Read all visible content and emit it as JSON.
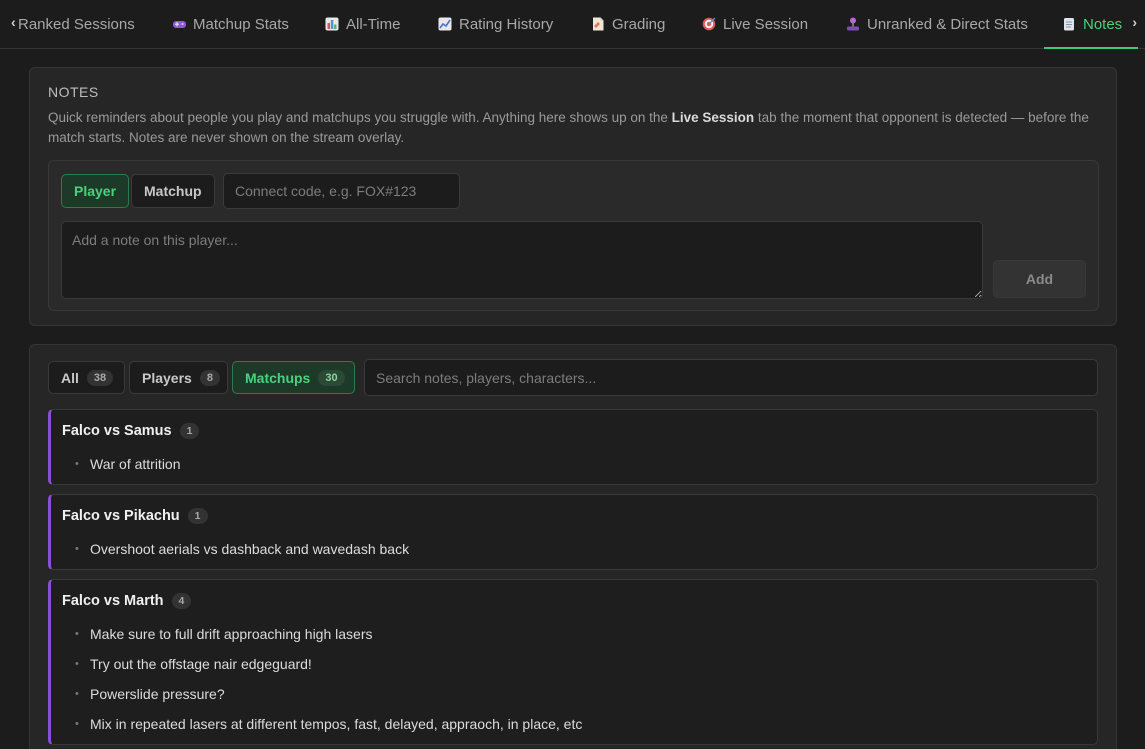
{
  "tabs": [
    {
      "label": "Ranked Sessions",
      "icon": "controller-icon",
      "color": "#d0d0d0"
    },
    {
      "label": "Matchup Stats",
      "icon": "gamepad-icon",
      "color": "#8a5bd6"
    },
    {
      "label": "All-Time",
      "icon": "bar-chart-icon",
      "color": "#5b8ed6"
    },
    {
      "label": "Rating History",
      "icon": "line-chart-icon",
      "color": "#7a8fd6"
    },
    {
      "label": "Grading",
      "icon": "document-icon",
      "color": "#e07a5a"
    },
    {
      "label": "Live Session",
      "icon": "target-icon",
      "color": "#e05a5a"
    },
    {
      "label": "Unranked & Direct Stats",
      "icon": "joystick-icon",
      "color": "#b56ad6"
    },
    {
      "label": "Notes",
      "icon": "notepad-icon",
      "color": "#cfd6e0",
      "active": true
    }
  ],
  "notes_panel": {
    "title": "NOTES",
    "desc_pre": "Quick reminders about people you play and matchups you struggle with. Anything here shows up on the ",
    "desc_bold": "Live Session",
    "desc_post": " tab the moment that opponent is detected — before the match starts. Notes are never shown on the stream overlay.",
    "player_label": "Player",
    "matchup_label": "Matchup",
    "code_placeholder": "Connect code, e.g. FOX#123",
    "note_placeholder": "Add a note on this player...",
    "add_label": "Add"
  },
  "filters": {
    "all": {
      "label": "All",
      "count": "38"
    },
    "players": {
      "label": "Players",
      "count": "8"
    },
    "matchups": {
      "label": "Matchups",
      "count": "30"
    },
    "search_placeholder": "Search notes, players, characters..."
  },
  "cards": [
    {
      "title": "Falco vs Samus",
      "count": "1",
      "notes": [
        "War of attrition"
      ]
    },
    {
      "title": "Falco vs Pikachu",
      "count": "1",
      "notes": [
        "Overshoot aerials vs dashback and wavedash back"
      ]
    },
    {
      "title": "Falco vs Marth",
      "count": "4",
      "notes": [
        "Make sure to full drift approaching high lasers",
        "Try out the offstage nair edgeguard!",
        "Powerslide pressure?",
        "Mix in repeated lasers at different tempos, fast, delayed, appraoch, in place, etc"
      ]
    }
  ],
  "colors": {
    "accent": "#4cd07d",
    "card_border": "#8a4fd6"
  }
}
